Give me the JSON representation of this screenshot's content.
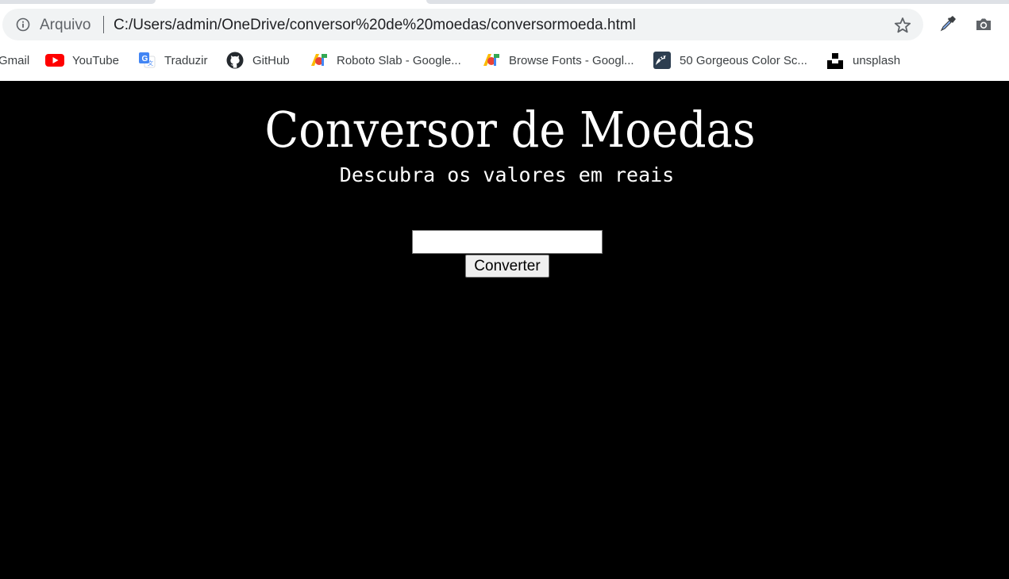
{
  "browser": {
    "omnibox": {
      "security_label": "Arquivo",
      "url": "C:/Users/admin/OneDrive/conversor%20de%20moedas/conversormoeda.html"
    },
    "icons": {
      "info": "info-icon",
      "star": "star-icon",
      "eyedropper": "eyedropper-icon",
      "camera": "camera-icon"
    },
    "bookmarks": [
      {
        "label": "Gmail",
        "icon": "gmail-icon"
      },
      {
        "label": "YouTube",
        "icon": "youtube-icon"
      },
      {
        "label": "Traduzir",
        "icon": "google-translate-icon"
      },
      {
        "label": "GitHub",
        "icon": "github-icon"
      },
      {
        "label": "Roboto Slab - Google...",
        "icon": "google-fonts-icon"
      },
      {
        "label": "Browse Fonts - Googl...",
        "icon": "google-fonts-icon"
      },
      {
        "label": "50 Gorgeous Color Sc...",
        "icon": "color-palette-icon"
      },
      {
        "label": "unsplash",
        "icon": "unsplash-icon"
      }
    ]
  },
  "page": {
    "title": "Conversor de Moedas",
    "subtitle": "Descubra os valores em reais",
    "input": {
      "value": "",
      "placeholder": ""
    },
    "convert_button_label": "Converter"
  },
  "colors": {
    "page_background": "#000000",
    "page_text": "#ffffff",
    "omnibox_background": "#f1f3f4",
    "youtube_red": "#ff0000"
  }
}
